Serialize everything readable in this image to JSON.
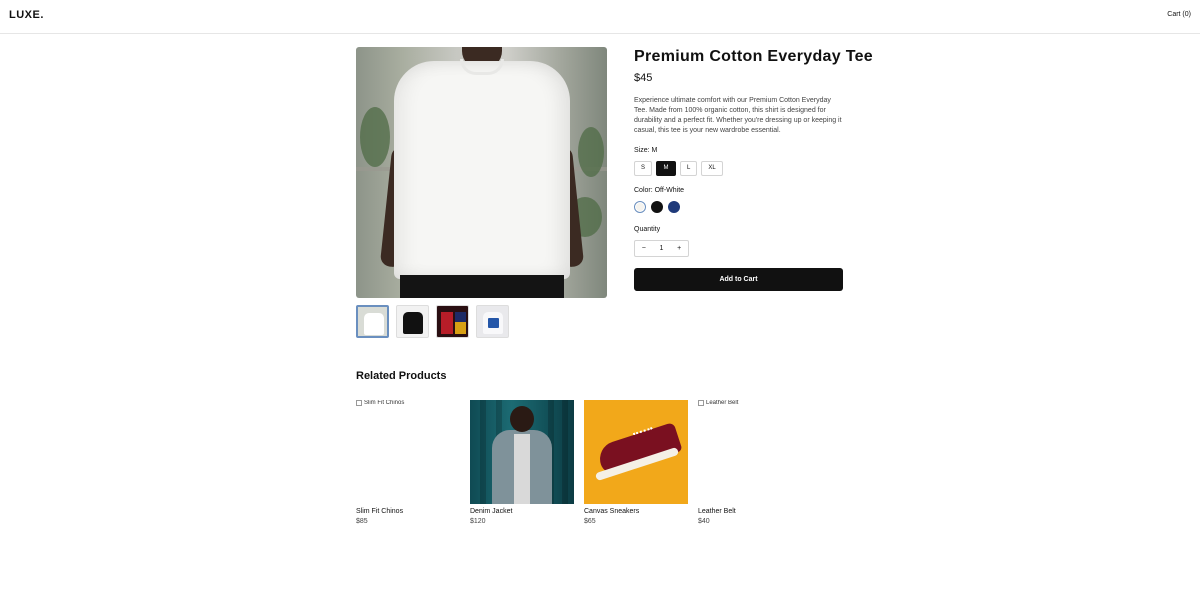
{
  "header": {
    "logo": "LUXE.",
    "cart": "Cart (0)"
  },
  "gallery": {
    "main_image_alt": "White cotton t-shirt on model",
    "thumbnails": [
      {
        "name": "white-tee",
        "active": true
      },
      {
        "name": "black-tee",
        "active": false
      },
      {
        "name": "color-blocks",
        "active": false
      },
      {
        "name": "printed-tee",
        "active": false
      }
    ]
  },
  "product": {
    "title": "Premium Cotton Everyday Tee",
    "price": "$45",
    "description": "Experience ultimate comfort with our Premium Cotton Everyday Tee. Made from 100% organic cotton, this shirt is designed for durability and a perfect fit. Whether you're dressing up or keeping it casual, this tee is your new wardrobe essential.",
    "size_label": "Size: M",
    "sizes": [
      "S",
      "M",
      "L",
      "XL"
    ],
    "selected_size": "M",
    "color_label": "Color: Off-White",
    "colors": [
      {
        "name": "Off-White",
        "hex": "#f5f3ee",
        "selected": true
      },
      {
        "name": "Black",
        "hex": "#111111",
        "selected": false
      },
      {
        "name": "Navy",
        "hex": "#1f3a7a",
        "selected": false
      }
    ],
    "quantity_label": "Quantity",
    "quantity": "1",
    "decrement": "−",
    "increment": "+",
    "add_to_cart": "Add to Cart"
  },
  "related": {
    "title": "Related Products",
    "items": [
      {
        "name": "Slim Fit Chinos",
        "price": "$85",
        "alt": "Slim Fit Chinos",
        "image_loaded": false
      },
      {
        "name": "Denim Jacket",
        "price": "$120",
        "alt": "Denim Jacket",
        "image_loaded": true
      },
      {
        "name": "Canvas Sneakers",
        "price": "$65",
        "alt": "Canvas Sneakers",
        "image_loaded": true
      },
      {
        "name": "Leather Belt",
        "price": "$40",
        "alt": "Leather Belt",
        "image_loaded": false
      }
    ]
  }
}
